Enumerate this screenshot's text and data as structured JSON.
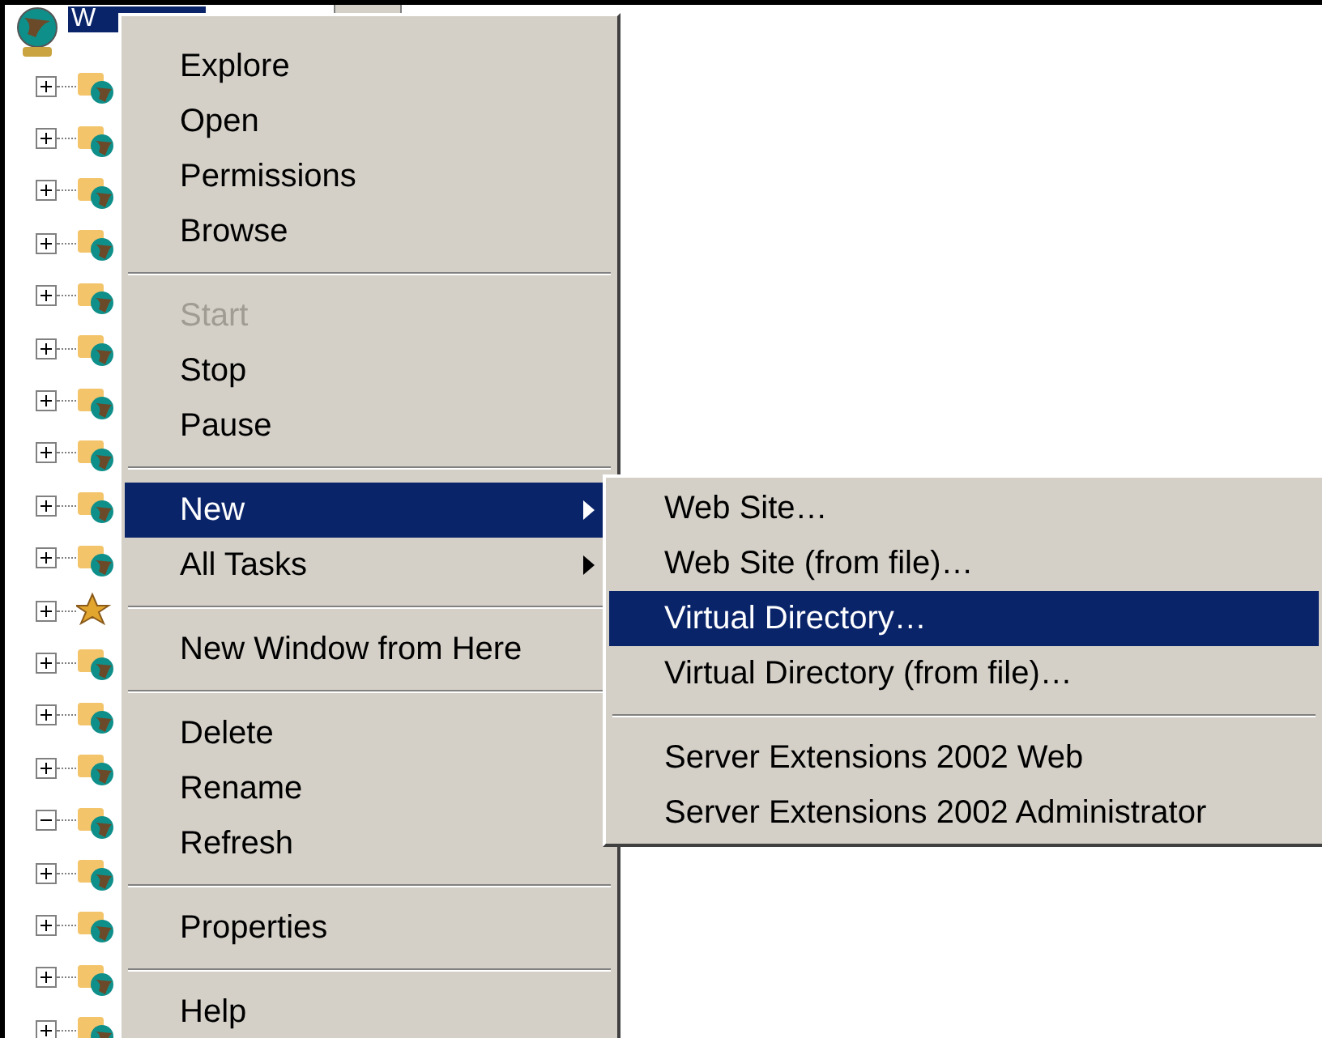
{
  "tree": {
    "root": {
      "label": "W",
      "selected": true
    },
    "items": [
      {
        "kind": "site",
        "expanded": false
      },
      {
        "kind": "site",
        "expanded": false
      },
      {
        "kind": "site",
        "expanded": false
      },
      {
        "kind": "site",
        "expanded": false
      },
      {
        "kind": "site",
        "expanded": false
      },
      {
        "kind": "site",
        "expanded": false
      },
      {
        "kind": "site",
        "expanded": false
      },
      {
        "kind": "site",
        "expanded": false
      },
      {
        "kind": "site",
        "expanded": false
      },
      {
        "kind": "site",
        "expanded": false
      },
      {
        "kind": "service",
        "expanded": false
      },
      {
        "kind": "site",
        "expanded": false
      },
      {
        "kind": "site",
        "expanded": false
      },
      {
        "kind": "site",
        "expanded": false
      },
      {
        "kind": "site",
        "expanded": true
      },
      {
        "kind": "site",
        "expanded": false
      },
      {
        "kind": "site",
        "expanded": false
      },
      {
        "kind": "site",
        "expanded": false
      },
      {
        "kind": "site",
        "expanded": false
      }
    ]
  },
  "context_menu": [
    {
      "kind": "item",
      "label": "Explore",
      "disabled": false,
      "selected": false,
      "submenu": false
    },
    {
      "kind": "item",
      "label": "Open",
      "disabled": false,
      "selected": false,
      "submenu": false
    },
    {
      "kind": "item",
      "label": "Permissions",
      "disabled": false,
      "selected": false,
      "submenu": false
    },
    {
      "kind": "item",
      "label": "Browse",
      "disabled": false,
      "selected": false,
      "submenu": false
    },
    {
      "kind": "separator"
    },
    {
      "kind": "item",
      "label": "Start",
      "disabled": true,
      "selected": false,
      "submenu": false
    },
    {
      "kind": "item",
      "label": "Stop",
      "disabled": false,
      "selected": false,
      "submenu": false
    },
    {
      "kind": "item",
      "label": "Pause",
      "disabled": false,
      "selected": false,
      "submenu": false
    },
    {
      "kind": "separator"
    },
    {
      "kind": "item",
      "label": "New",
      "disabled": false,
      "selected": true,
      "submenu": true
    },
    {
      "kind": "item",
      "label": "All Tasks",
      "disabled": false,
      "selected": false,
      "submenu": true
    },
    {
      "kind": "separator"
    },
    {
      "kind": "item",
      "label": "New Window from Here",
      "disabled": false,
      "selected": false,
      "submenu": false
    },
    {
      "kind": "separator"
    },
    {
      "kind": "item",
      "label": "Delete",
      "disabled": false,
      "selected": false,
      "submenu": false
    },
    {
      "kind": "item",
      "label": "Rename",
      "disabled": false,
      "selected": false,
      "submenu": false
    },
    {
      "kind": "item",
      "label": "Refresh",
      "disabled": false,
      "selected": false,
      "submenu": false
    },
    {
      "kind": "separator"
    },
    {
      "kind": "item",
      "label": "Properties",
      "disabled": false,
      "selected": false,
      "submenu": false
    },
    {
      "kind": "separator"
    },
    {
      "kind": "item",
      "label": "Help",
      "disabled": false,
      "selected": false,
      "submenu": false
    }
  ],
  "submenu": [
    {
      "kind": "item",
      "label": "Web Site…",
      "disabled": false,
      "selected": false,
      "submenu": false
    },
    {
      "kind": "item",
      "label": "Web Site (from file)…",
      "disabled": false,
      "selected": false,
      "submenu": false
    },
    {
      "kind": "item",
      "label": "Virtual Directory…",
      "disabled": false,
      "selected": true,
      "submenu": false
    },
    {
      "kind": "item",
      "label": "Virtual Directory (from file)…",
      "disabled": false,
      "selected": false,
      "submenu": false
    },
    {
      "kind": "separator"
    },
    {
      "kind": "item",
      "label": "Server Extensions 2002 Web",
      "disabled": false,
      "selected": false,
      "submenu": false
    },
    {
      "kind": "item",
      "label": "Server Extensions 2002 Administrator",
      "disabled": false,
      "selected": false,
      "submenu": false
    }
  ]
}
